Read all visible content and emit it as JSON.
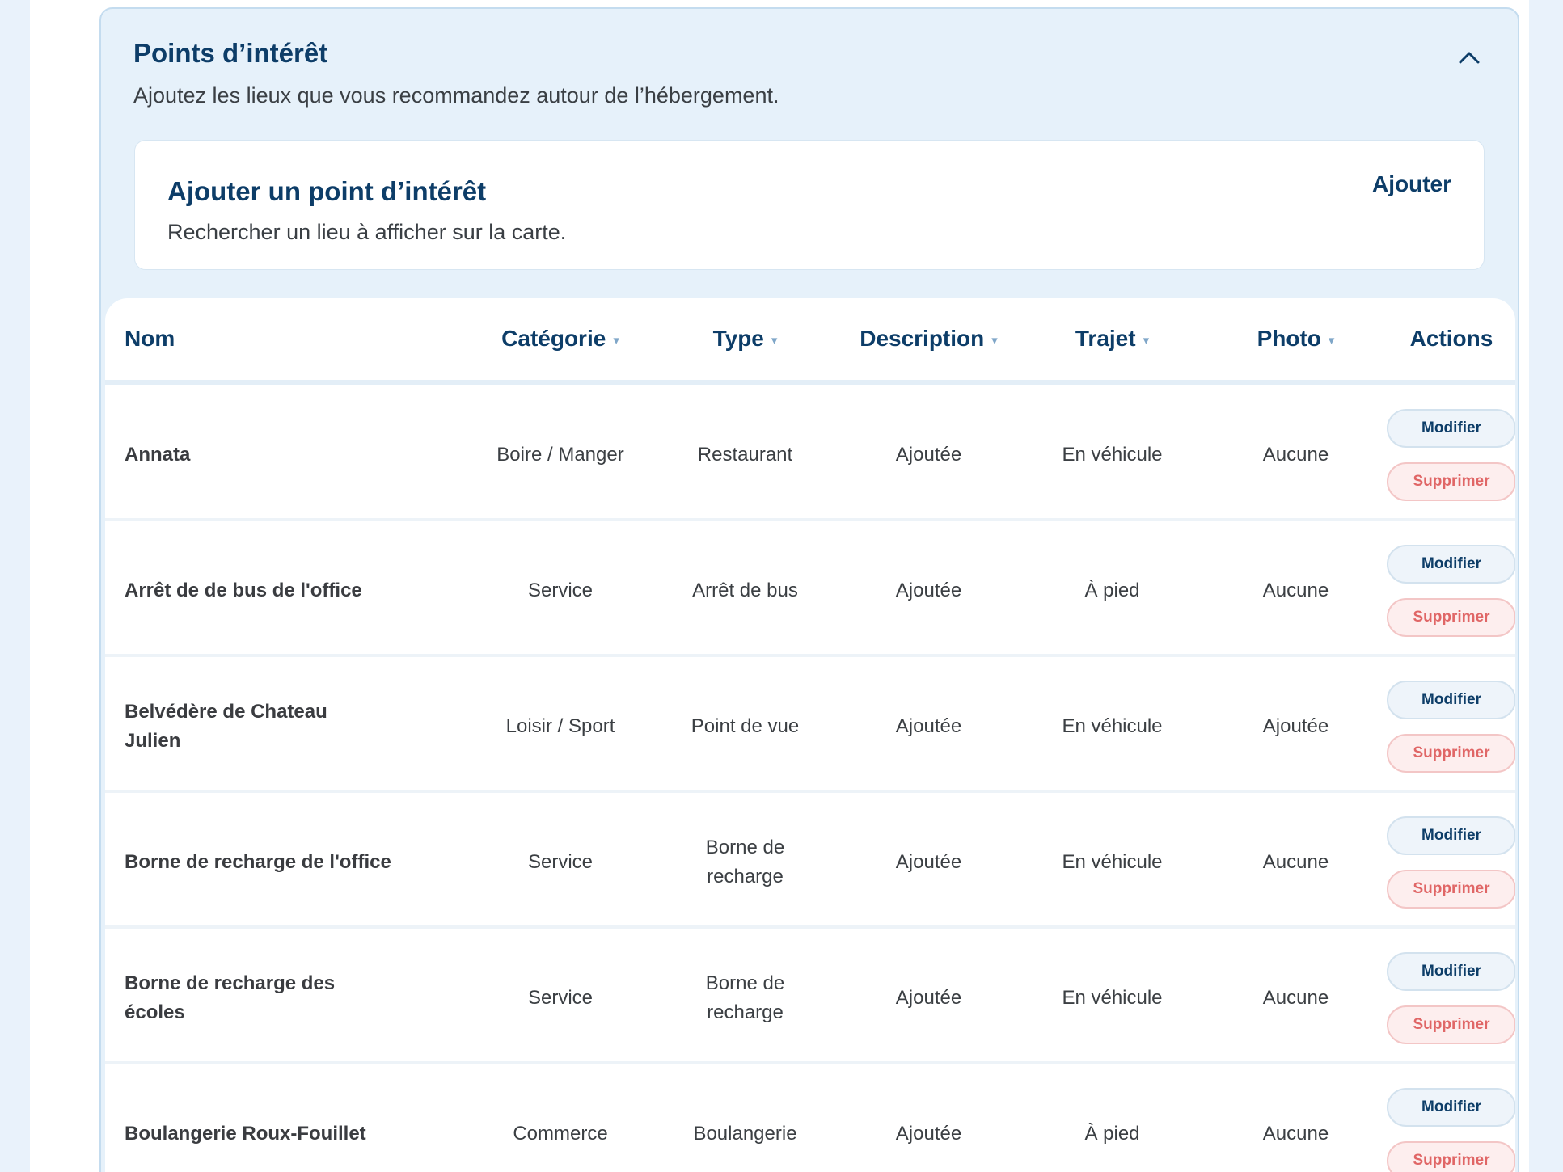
{
  "section": {
    "title": "Points d’intérêt",
    "subtitle": "Ajoutez les lieux que vous recommandez autour de l’hébergement.",
    "collapse_icon": "chevron-up-icon"
  },
  "add_card": {
    "title": "Ajouter un point d’intérêt",
    "subtitle": "Rechercher un lieu à afficher sur la carte.",
    "button_label": "Ajouter"
  },
  "table": {
    "headers": {
      "nom": "Nom",
      "categorie": "Catégorie",
      "type": "Type",
      "description": "Description",
      "trajet": "Trajet",
      "photo": "Photo",
      "actions": "Actions"
    },
    "sort_icon": "▾",
    "action_labels": {
      "modify": "Modifier",
      "delete": "Supprimer"
    },
    "rows": [
      {
        "nom": "Annata",
        "categorie": "Boire / Manger",
        "type": "Restaurant",
        "description": "Ajoutée",
        "trajet": "En véhicule",
        "photo": "Aucune"
      },
      {
        "nom": "Arrêt de de bus de l'office",
        "categorie": "Service",
        "type": "Arrêt de bus",
        "description": "Ajoutée",
        "trajet": "À pied",
        "photo": "Aucune"
      },
      {
        "nom": "Belvédère de Chateau Julien",
        "categorie": "Loisir / Sport",
        "type": "Point de vue",
        "description": "Ajoutée",
        "trajet": "En véhicule",
        "photo": "Ajoutée"
      },
      {
        "nom": "Borne de recharge de l'office",
        "categorie": "Service",
        "type": "Borne de recharge",
        "description": "Ajoutée",
        "trajet": "En véhicule",
        "photo": "Aucune"
      },
      {
        "nom": "Borne de recharge des écoles",
        "categorie": "Service",
        "type": "Borne de recharge",
        "description": "Ajoutée",
        "trajet": "En véhicule",
        "photo": "Aucune"
      },
      {
        "nom": "Boulangerie Roux-Fouillet",
        "categorie": "Commerce",
        "type": "Boulangerie",
        "description": "Ajoutée",
        "trajet": "À pied",
        "photo": "Aucune"
      }
    ]
  },
  "colors": {
    "background": "#e9f2fb",
    "panel": "#e6f1fa",
    "heading": "#0d3d68",
    "delete": "#e06666"
  }
}
